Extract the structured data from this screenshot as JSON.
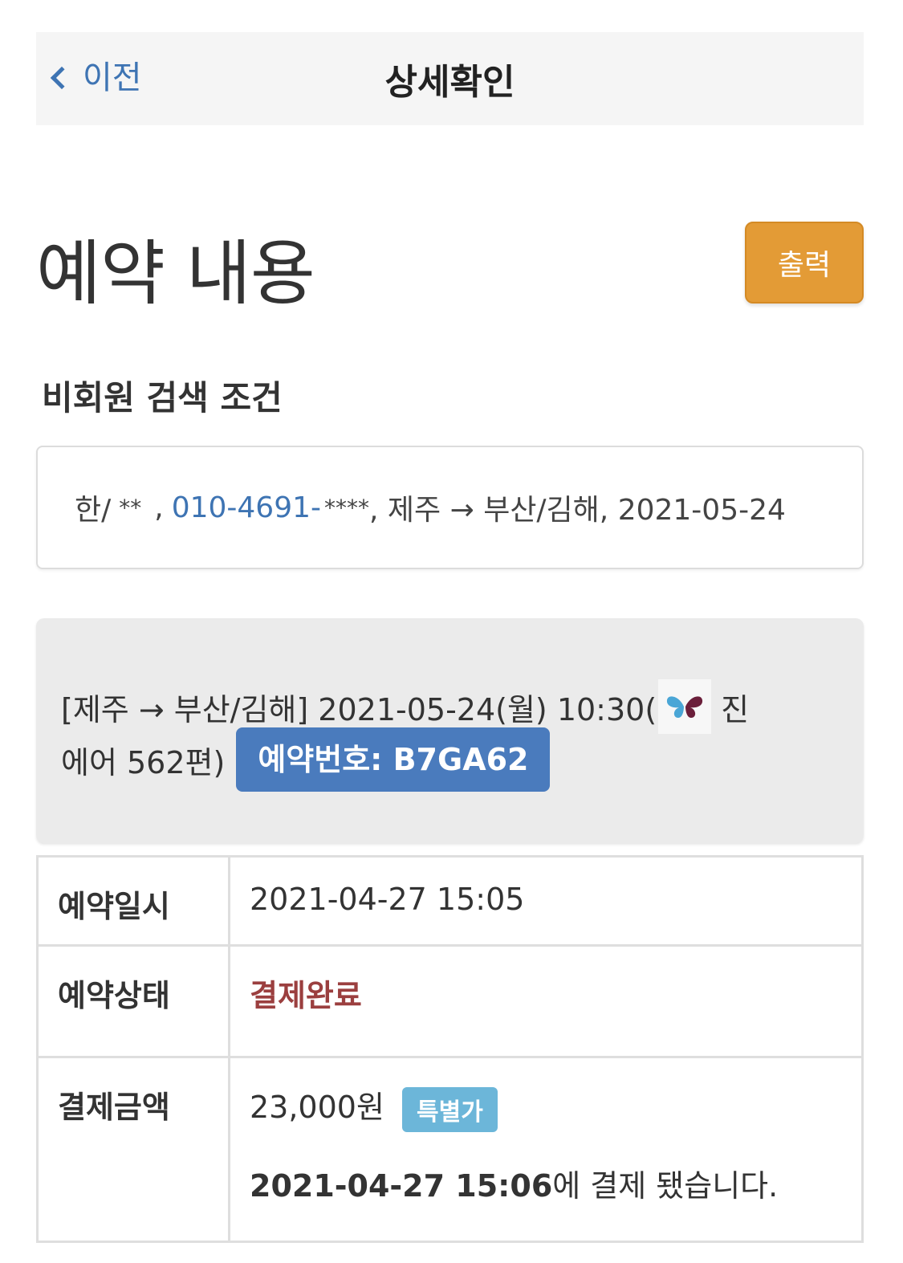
{
  "nav": {
    "back_label": "이전",
    "title": "상세확인"
  },
  "header": {
    "title": "예약 내용",
    "print_label": "출력"
  },
  "search": {
    "section_title": "비회원 검색 조건",
    "name_prefix": "한/",
    "name_mask": "**",
    "separator": ",",
    "phone": "010-4691-",
    "phone_mask": "****",
    "route_date": ", 제주 → 부산/김해, 2021-05-24"
  },
  "flight": {
    "line1": "[제주 → 부산/김해] 2021-05-24(월) 10:30(",
    "airline_suffix": "진",
    "line2": "에어 562편)",
    "reservation_badge": "예약번호: B7GA62",
    "airline_icon": "butterfly-logo-icon"
  },
  "details": {
    "rows": [
      {
        "label": "예약일시",
        "value": "2021-04-27 15:05"
      },
      {
        "label": "예약상태",
        "value": "결제완료"
      },
      {
        "label": "결제금액",
        "value": "23,000원"
      }
    ],
    "special_badge": "특별가",
    "paid_time": "2021-04-27 15:06",
    "paid_text": "에 결제 됐습니다."
  },
  "colors": {
    "accent_blue": "#3e74b3",
    "print_button": "#e39b36",
    "status_red": "#9b3f3f",
    "badge_blue": "#4a7bbd",
    "special_badge": "#6cb6d9"
  }
}
